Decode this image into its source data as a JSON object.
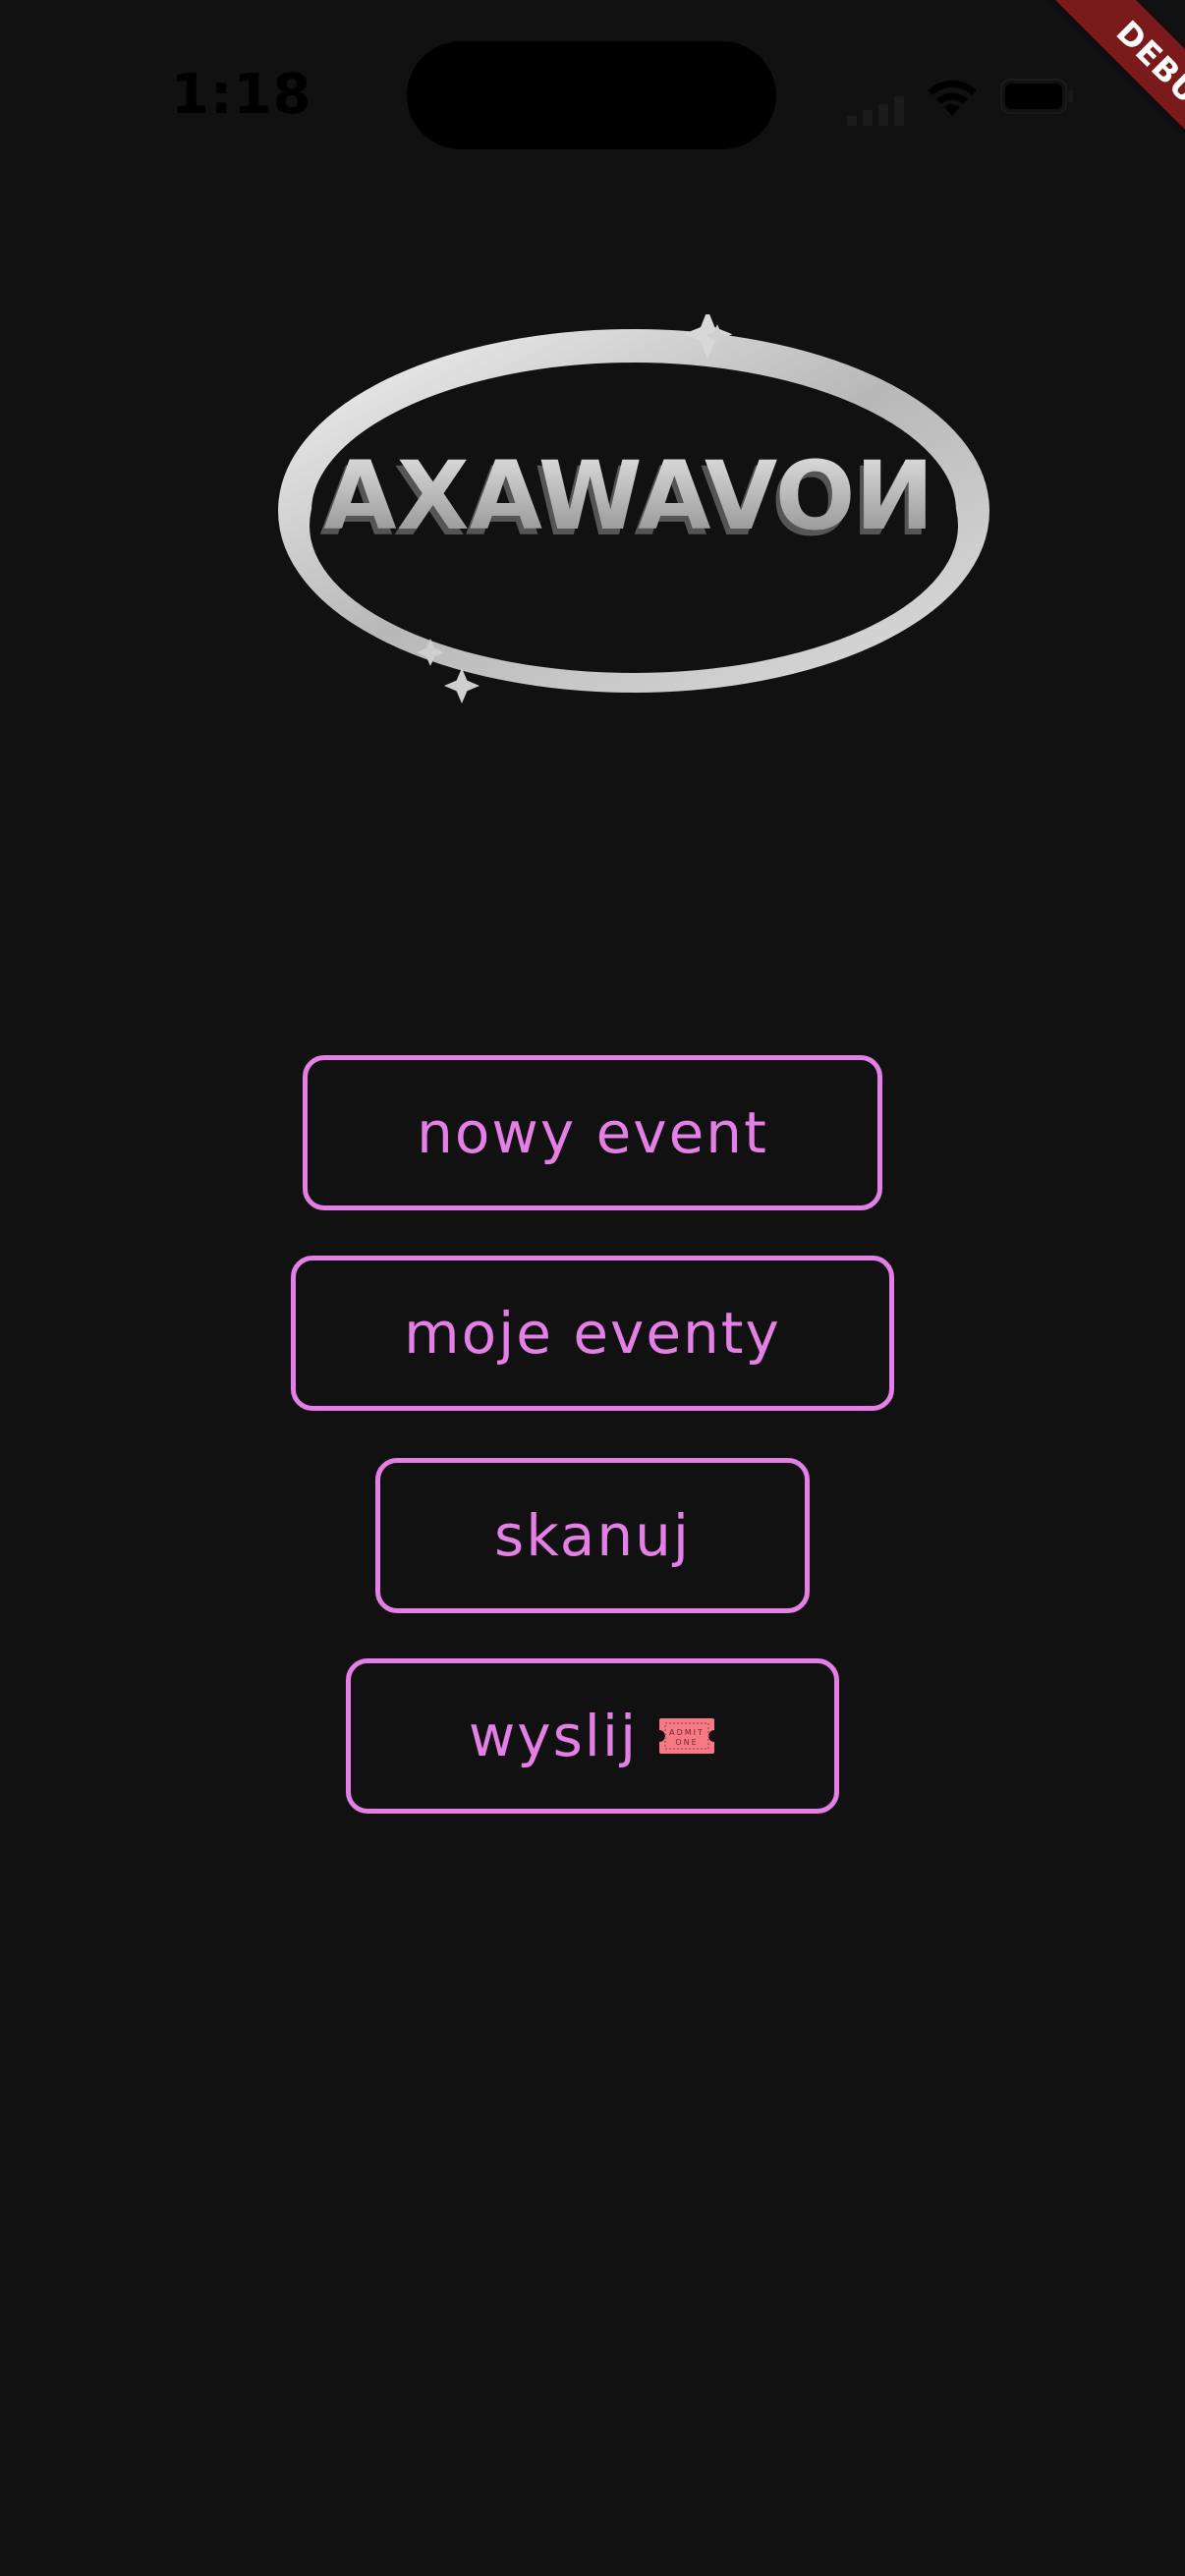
{
  "status_bar": {
    "time": "1:18",
    "icons": [
      "signal-icon",
      "wifi-icon",
      "battery-icon"
    ]
  },
  "debug_banner": {
    "label": "DEBUG",
    "color": "#7a1a1a"
  },
  "logo": {
    "text": "NOVAWAXA",
    "icon": "orbit-logo"
  },
  "menu": {
    "accent_color": "#e47fe6",
    "new_event_label": "nowy event",
    "my_events_label": "moje eventy",
    "scan_label": "skanuj",
    "send_label": "wyslij",
    "send_icon": "admit-one-ticket-icon",
    "ticket_text_top": "ADMIT",
    "ticket_text_bottom": "ONE"
  },
  "colors": {
    "background": "#111111",
    "accent": "#e47fe6"
  }
}
